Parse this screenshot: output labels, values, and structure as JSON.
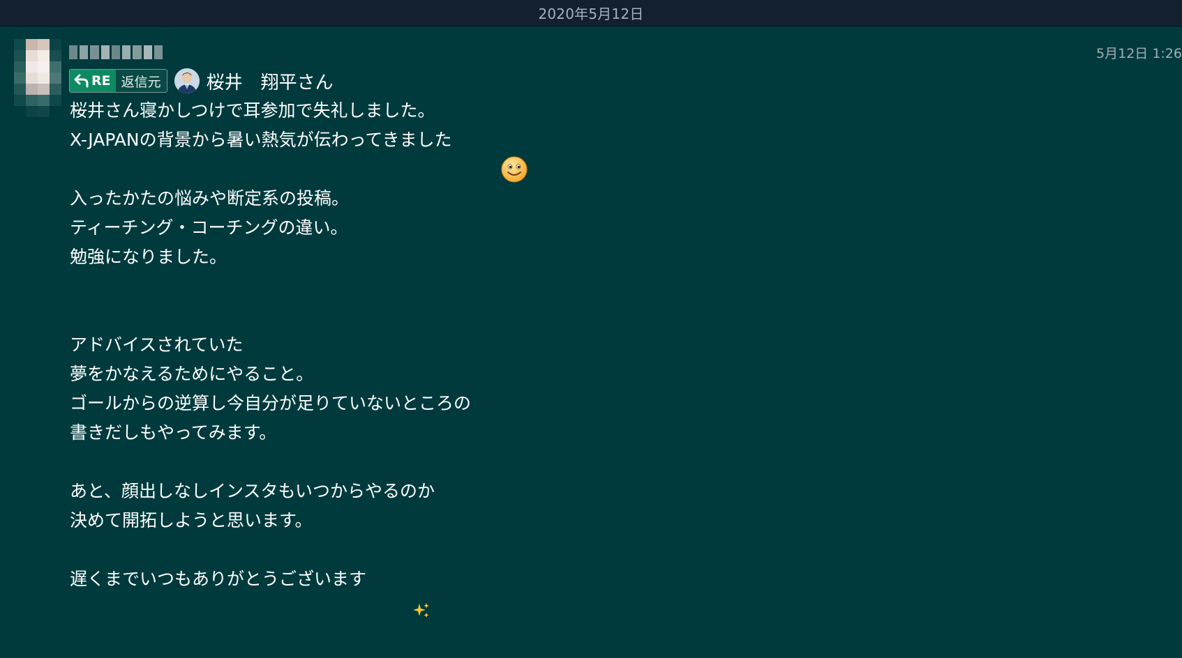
{
  "date_divider": {
    "label": "2020年5月12日"
  },
  "message": {
    "timestamp": "5月12日 1:26",
    "sender_name": "",
    "reply_badge": {
      "re_label": "RE",
      "source_label": "返信元"
    },
    "reply_to": {
      "name": "桜井　翔平さん"
    },
    "lines": [
      "桜井さん寝かしつけで耳参加で失礼しました。",
      "X-JAPANの背景から暑い熱気が伝わってきました",
      "",
      "入ったかたの悩みや断定系の投稿。",
      "ティーチング・コーチングの違い。",
      "勉強になりました。",
      "",
      "",
      "アドバイスされていた",
      "夢をかなえるためにやること。",
      "ゴールからの逆算し今自分が足りていないところの",
      "書きだしもやってみます。",
      "",
      "あと、顔出しなしインスタもいつからやるのか",
      "決めて開拓しようと思います。",
      "",
      "遅くまでいつもありがとうございます"
    ],
    "icons": {
      "reply_arrow": "reply-arrow-icon",
      "smiley": "smiley-emoji-icon",
      "sparkles": "sparkles-emoji-icon"
    }
  },
  "colors": {
    "background": "#003a3d",
    "date_bar": "#13212f",
    "badge_green": "#0e8a63",
    "text": "#ffffff",
    "muted_text": "#a3b0b5"
  }
}
